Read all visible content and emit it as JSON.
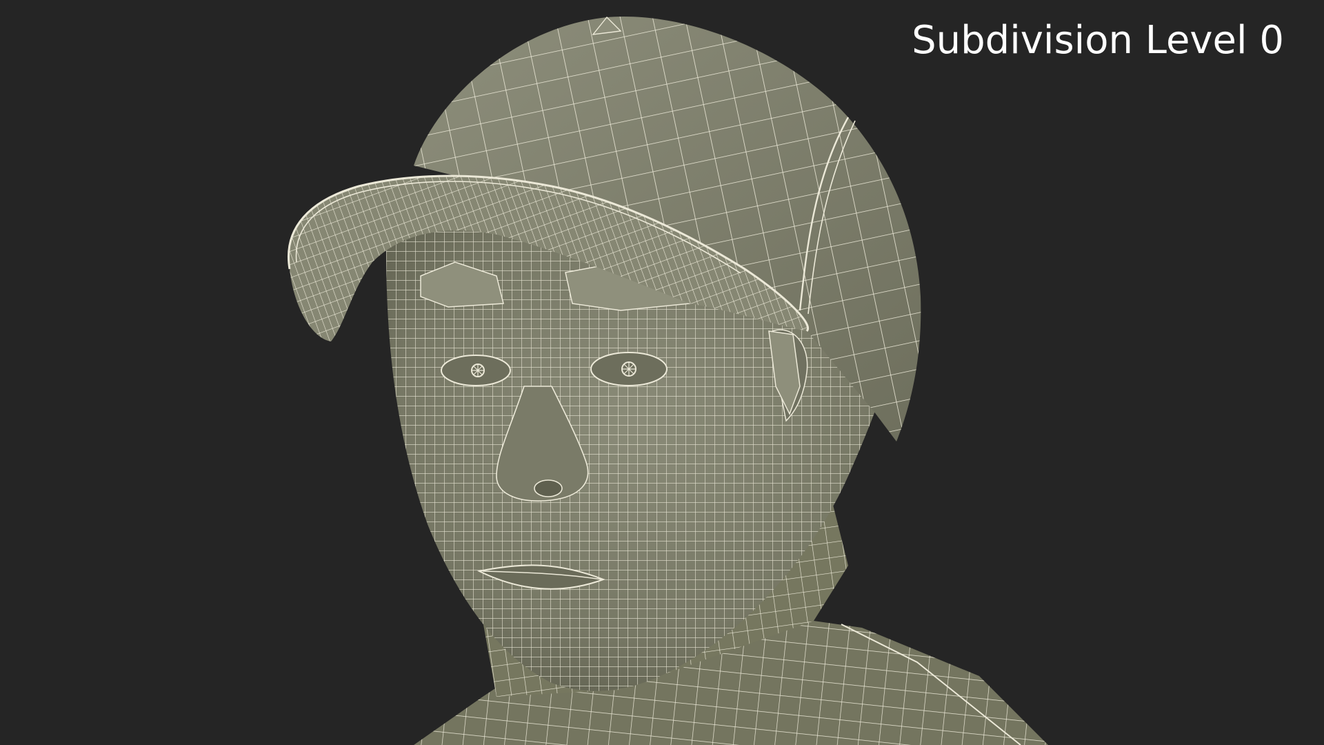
{
  "scene": {
    "caption": "Subdivision Level 0",
    "subject": "wireframe-head-with-cap",
    "colors": {
      "background": "#252525",
      "surface": "#7f806e",
      "surface_dark": "#6b6c5b",
      "wireframe": "#ece9d8",
      "caption_text": "#ffffff"
    }
  }
}
